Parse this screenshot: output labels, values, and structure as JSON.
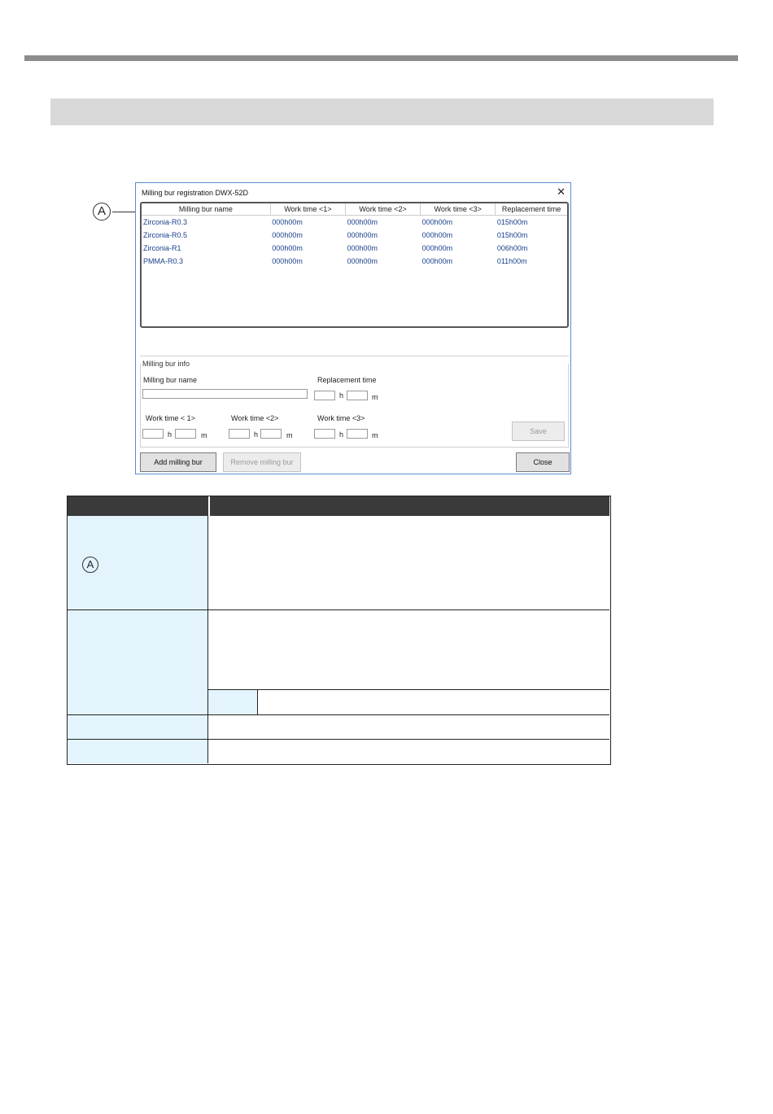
{
  "dialog": {
    "title": "Milling bur registration DWX-52D",
    "close_glyph": "✕",
    "list": {
      "columns": [
        "Milling bur name",
        "Work time <1>",
        "Work time <2>",
        "Work time <3>",
        "Replacement time"
      ],
      "rows": [
        [
          "Zirconia-R0.3",
          "000h00m",
          "000h00m",
          "000h00m",
          "015h00m"
        ],
        [
          "Zirconia-R0.5",
          "000h00m",
          "000h00m",
          "000h00m",
          "015h00m"
        ],
        [
          "Zirconia-R1",
          "000h00m",
          "000h00m",
          "000h00m",
          "006h00m"
        ],
        [
          "PMMA-R0.3",
          "000h00m",
          "000h00m",
          "000h00m",
          "011h00m"
        ]
      ]
    },
    "info": {
      "section_title": "Milling bur info",
      "name_label": "Milling bur name",
      "replacement_label": "Replacement time",
      "work1_label": "Work time < 1>",
      "work2_label": "Work time <2>",
      "work3_label": "Work time <3>",
      "hour_unit": "h",
      "minute_unit": "m",
      "save_label": "Save"
    },
    "buttons": {
      "add": "Add milling bur",
      "remove": "Remove milling bur",
      "close": "Close"
    }
  },
  "callout_letter": "A",
  "colors": {
    "list_text": "#1a3f8c",
    "table_label_bg": "#e3f4fc",
    "header_bg": "#3a3a3a"
  }
}
